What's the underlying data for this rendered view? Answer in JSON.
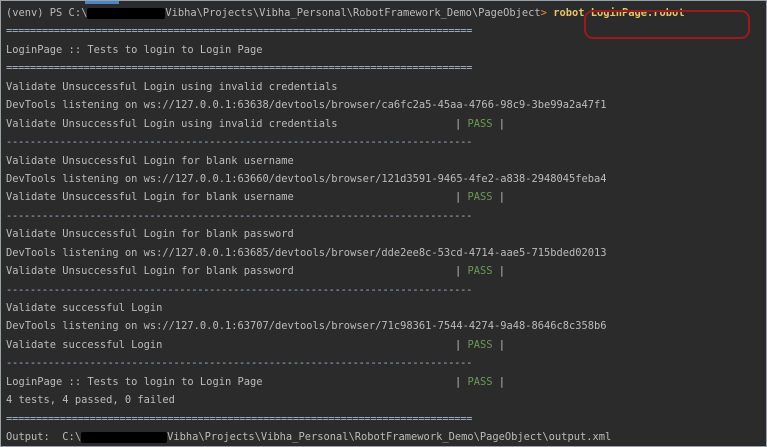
{
  "terminal": {
    "prompt": {
      "prefix": "(venv) PS C:\\",
      "path": "Vibha\\Projects\\Vibha_Personal\\RobotFramework_Demo\\PageObject",
      "arrow": ">",
      "command": "robot LoginPage.robot"
    },
    "separator_double": "==============================================================================",
    "separator_single": "------------------------------------------------------------------------------",
    "suite_title": "LoginPage :: Tests to login to Login Page",
    "tests": [
      {
        "name": "Validate Unsuccessful Login using invalid credentials",
        "devtools": "DevTools listening on ws://127.0.0.1:63638/devtools/browser/ca6fc2a5-45aa-4766-98c9-3be99a2a47f1",
        "result": "PASS"
      },
      {
        "name": "Validate Unsuccessful Login for blank username",
        "devtools": "DevTools listening on ws://127.0.0.1:63660/devtools/browser/121d3591-9465-4fe2-a838-2948045feba4",
        "result": "PASS"
      },
      {
        "name": "Validate Unsuccessful Login for blank password",
        "devtools": "DevTools listening on ws://127.0.0.1:63685/devtools/browser/dde2ee8c-53cd-4714-aae5-715bded02013",
        "result": "PASS"
      },
      {
        "name": "Validate successful Login",
        "devtools": "DevTools listening on ws://127.0.0.1:63707/devtools/browser/71c98361-7544-4274-9a48-8646c8c358b6",
        "result": "PASS"
      }
    ],
    "suite_summary": {
      "name": "LoginPage :: Tests to login to Login Page",
      "result": "PASS",
      "stats": "4 tests, 4 passed, 0 failed"
    },
    "output": {
      "label": "Output:  C:\\",
      "path": "Vibha\\Projects\\Vibha_Personal\\RobotFramework_Demo\\PageObject\\output.xml"
    },
    "result_prefix": "| ",
    "result_suffix": " |",
    "colors": {
      "background": "#2b2b2b",
      "text": "#bbbbbb",
      "pass": "#6a9955",
      "command": "#e8c46a",
      "highlight_ring": "#9b1b1b"
    }
  }
}
